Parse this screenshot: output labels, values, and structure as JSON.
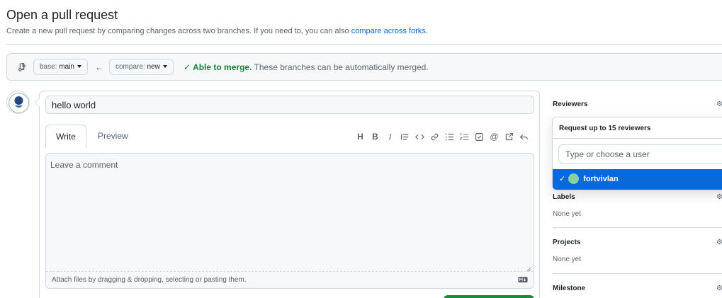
{
  "header": {
    "title": "Open a pull request",
    "subtitle": "Create a new pull request by comparing changes across two branches. If you need to, you can also",
    "subtitle_link": "compare across forks."
  },
  "compare_bar": {
    "base_prefix": "base:",
    "base_branch": "main",
    "compare_prefix": "compare:",
    "compare_branch": "new",
    "merge_status_bold": "Able to merge.",
    "merge_status_text": "These branches can be automatically merged."
  },
  "editor": {
    "title_value": "hello world",
    "tabs": [
      {
        "label": "Write",
        "active": true
      },
      {
        "label": "Preview",
        "active": false
      }
    ],
    "toolbar_icons": [
      "heading-icon",
      "bold-icon",
      "italic-icon",
      "quote-icon",
      "code-icon",
      "link-icon",
      "unordered-list-icon",
      "ordered-list-icon",
      "task-list-icon",
      "mention-icon",
      "cross-reference-icon",
      "reply-icon"
    ],
    "comment_placeholder": "Leave a comment",
    "attach_text": "Attach files by dragging & dropping, selecting or pasting them."
  },
  "sidebar": {
    "reviewers_label": "Reviewers",
    "popup_title": "Request up to 15 reviewers",
    "popup_input_placeholder": "Type or choose a user",
    "selected_reviewer": "fortvivlan",
    "labels_label": "Labels",
    "labels_value": "None yet",
    "projects_label": "Projects",
    "projects_value": "None yet",
    "milestone_label": "Milestone"
  },
  "colors": {
    "accent_blue": "#0969da",
    "success_green": "#1a7f37",
    "button_green": "#1f883d",
    "border": "#d1d9e0"
  }
}
